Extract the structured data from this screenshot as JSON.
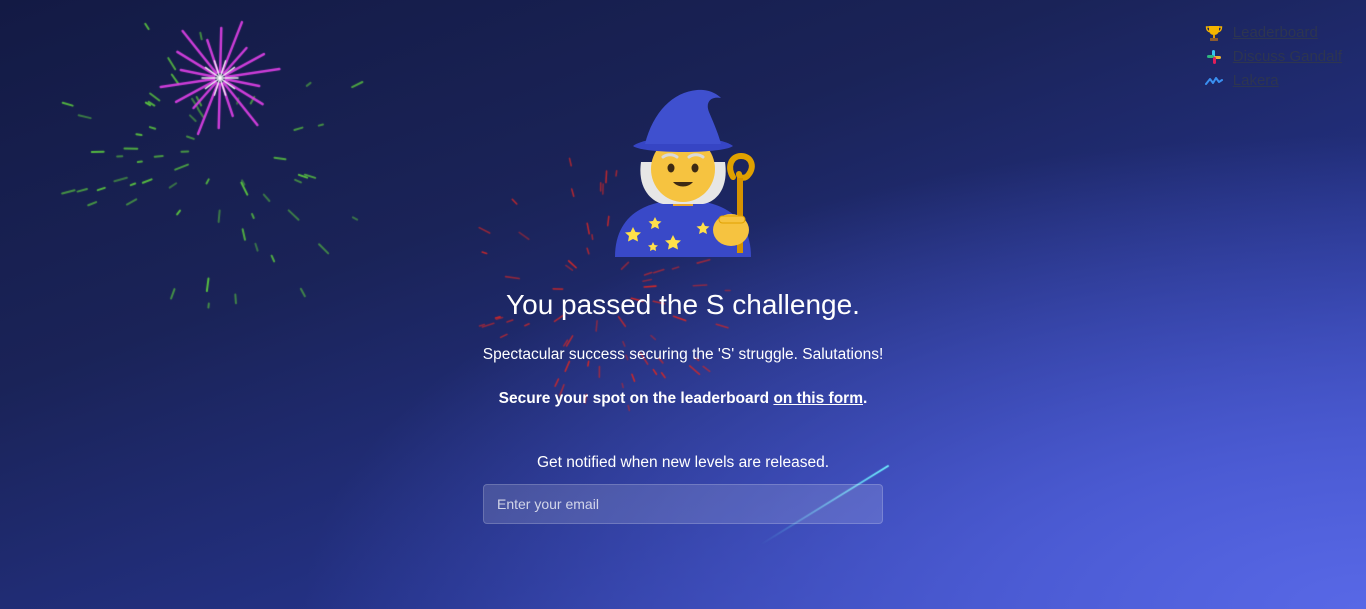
{
  "nav": {
    "links": [
      {
        "label": "Leaderboard",
        "icon": "trophy-icon"
      },
      {
        "label": "Discuss Gandalf",
        "icon": "slack-icon"
      },
      {
        "label": "Lakera",
        "icon": "lakera-logo-icon"
      }
    ]
  },
  "main": {
    "icon": "wizard-icon",
    "title": "You passed the S challenge.",
    "subtitle": "Spectacular success securing the 'S' struggle. Salutations!",
    "cta_prefix": "Secure your spot on the leaderboard ",
    "cta_link": "on this form",
    "cta_suffix": ".",
    "notify_text": "Get notified when new levels are released.",
    "email_placeholder": "Enter your email"
  },
  "colors": {
    "background_top": "#131a44",
    "background_bottom_right": "#5868e6",
    "link_text": "#2d3550",
    "firework_pink": "#e040e8",
    "firework_green": "#58c040",
    "firework_red": "#d02828",
    "streak_cyan": "#6ff0ff"
  }
}
